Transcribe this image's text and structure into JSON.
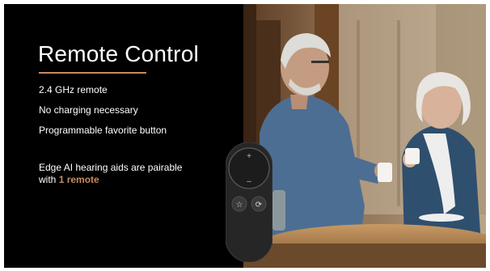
{
  "slide": {
    "title": "Remote Control",
    "bullets": [
      "2.4 GHz remote",
      "No charging necessary",
      "Programmable favorite button"
    ],
    "note_prefix": "Edge AI hearing aids are pairable with ",
    "note_highlight": "1 remote"
  },
  "remote": {
    "plus": "+",
    "minus": "–",
    "star_icon": "star-icon",
    "cycle_icon": "cycle-icon"
  },
  "colors": {
    "accent": "#c88a5e",
    "background": "#000000"
  }
}
